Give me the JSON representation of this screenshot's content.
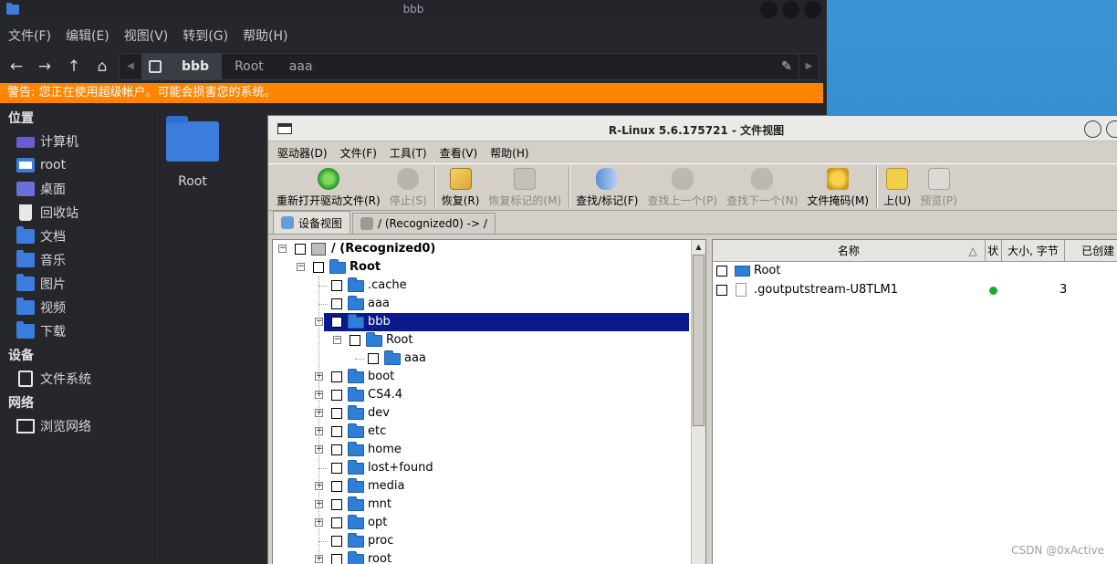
{
  "file_manager": {
    "title": "bbb",
    "menu": [
      "文件(F)",
      "编辑(E)",
      "视图(V)",
      "转到(G)",
      "帮助(H)"
    ],
    "path": [
      "bbb",
      "Root",
      "aaa"
    ],
    "warning": "警告: 您正在使用超级帐户。可能会损害您的系统。",
    "sidebar": {
      "places_header": "位置",
      "places": [
        {
          "label": "计算机",
          "icon": "computer-icon"
        },
        {
          "label": "root",
          "icon": "home-folder-icon"
        },
        {
          "label": "桌面",
          "icon": "desktop-icon"
        },
        {
          "label": "回收站",
          "icon": "trash-icon"
        },
        {
          "label": "文档",
          "icon": "documents-folder-icon"
        },
        {
          "label": "音乐",
          "icon": "music-folder-icon"
        },
        {
          "label": "图片",
          "icon": "pictures-folder-icon"
        },
        {
          "label": "视频",
          "icon": "videos-folder-icon"
        },
        {
          "label": "下载",
          "icon": "downloads-folder-icon"
        }
      ],
      "devices_header": "设备",
      "devices": [
        {
          "label": "文件系统",
          "icon": "drive-icon"
        }
      ],
      "network_header": "网络",
      "network": [
        {
          "label": "浏览网络",
          "icon": "network-icon"
        }
      ]
    },
    "content": {
      "folder_label": "Root"
    }
  },
  "rlinux": {
    "title": "R-Linux 5.6.175721 - 文件视图",
    "menu": [
      "驱动器(D)",
      "文件(F)",
      "工具(T)",
      "查看(V)",
      "帮助(H)"
    ],
    "toolbar": [
      {
        "label": "重新打开驱动文件(R)",
        "icon": "reopen-icon",
        "enabled": true
      },
      {
        "label": "停止(S)",
        "icon": "stop-icon",
        "enabled": false
      },
      {
        "label": "恢复(R)",
        "icon": "recover-icon",
        "enabled": true
      },
      {
        "label": "恢复标记的(M)",
        "icon": "recover-marked-icon",
        "enabled": false
      },
      {
        "label": "查找/标记(F)",
        "icon": "find-icon",
        "enabled": true
      },
      {
        "label": "查找上一个(P)",
        "icon": "find-previous-icon",
        "enabled": false
      },
      {
        "label": "查找下一个(N)",
        "icon": "find-next-icon",
        "enabled": false
      },
      {
        "label": "文件掩码(M)",
        "icon": "file-mask-icon",
        "enabled": true
      },
      {
        "label": "上(U)",
        "icon": "up-folder-icon",
        "enabled": true
      },
      {
        "label": "预览(P)",
        "icon": "preview-icon",
        "enabled": false
      }
    ],
    "tabs": [
      "设备视图",
      "/ (Recognized0) -> /"
    ],
    "tree": [
      {
        "label": "/ (Recognized0)",
        "level": 0,
        "expander": "−",
        "bold": true,
        "icon": "drive"
      },
      {
        "label": "Root",
        "level": 1,
        "expander": "−",
        "bold": true
      },
      {
        "label": ".cache",
        "level": 2,
        "expander": ""
      },
      {
        "label": "aaa",
        "level": 2,
        "expander": ""
      },
      {
        "label": "bbb",
        "level": 2,
        "expander": "−",
        "selected": true
      },
      {
        "label": "Root",
        "level": 3,
        "expander": "−"
      },
      {
        "label": "aaa",
        "level": 4,
        "expander": ""
      },
      {
        "label": "boot",
        "level": 2,
        "expander": "+"
      },
      {
        "label": "CS4.4",
        "level": 2,
        "expander": "+"
      },
      {
        "label": "dev",
        "level": 2,
        "expander": "+"
      },
      {
        "label": "etc",
        "level": 2,
        "expander": "+"
      },
      {
        "label": "home",
        "level": 2,
        "expander": "+"
      },
      {
        "label": "lost+found",
        "level": 2,
        "expander": ""
      },
      {
        "label": "media",
        "level": 2,
        "expander": "+"
      },
      {
        "label": "mnt",
        "level": 2,
        "expander": "+"
      },
      {
        "label": "opt",
        "level": 2,
        "expander": "+"
      },
      {
        "label": "proc",
        "level": 2,
        "expander": ""
      },
      {
        "label": "root",
        "level": 2,
        "expander": "+"
      }
    ],
    "list": {
      "columns": [
        "名称",
        "状",
        "大小, 字节",
        "已创建"
      ],
      "rows": [
        {
          "name": "Root",
          "type": "folder",
          "status": false,
          "size": ""
        },
        {
          "name": ".goutputstream-U8TLM1",
          "type": "file",
          "status": true,
          "size": "3"
        }
      ]
    }
  },
  "watermark": "CSDN @0xActive",
  "colors": {
    "warning": "#ff8400",
    "selection": "#0a1a8c",
    "folder": "#2f7fd6",
    "status_dot": "#1aaa3a"
  }
}
